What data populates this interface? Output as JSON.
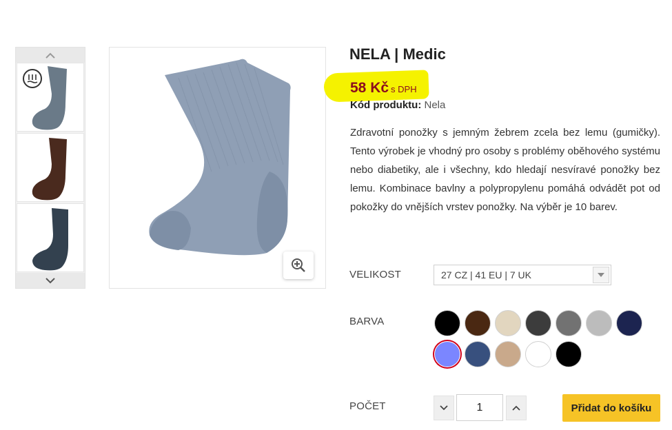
{
  "product": {
    "title": "NELA | Medic",
    "price": "58 Kč",
    "price_note": "s DPH",
    "code_label": "Kód produktu:",
    "code_value": "Nela",
    "description": "Zdravotní ponožky s jemným žebrem zcela bez lemu (gumičky). Tento výrobek je vhodný pro osoby s problémy oběhového systému nebo diabetiky, ale i všechny, kdo hledají nesvíravé ponožky bez lemu. Kombinace bavlny a polypropylenu pomáhá odvádět pot od pokožky do vnějších vrstev ponožky. Na výběr je 10 barev."
  },
  "gallery": {
    "thumbnails": [
      {
        "color": "#6a7a88"
      },
      {
        "color": "#4a2a1e"
      },
      {
        "color": "#33414f"
      }
    ],
    "main_color": "#8f9fb5",
    "badge_icon": "medical-badge-icon",
    "zoom_icon": "zoom-in-icon"
  },
  "size": {
    "label": "VELIKOST",
    "selected": "27 CZ | 41 EU | 7 UK"
  },
  "color": {
    "label": "BARVA",
    "swatches": [
      "#000000",
      "#4a2812",
      "#e2d6bf",
      "#3c3c3c",
      "#727272",
      "#bcbcbc",
      "#1c2450",
      "#7b86ff",
      "#38507e",
      "#c9a98b",
      "#ffffff",
      "#000000"
    ],
    "selected_index": 7
  },
  "quantity": {
    "label": "POČET",
    "value": "1"
  },
  "cart": {
    "button_label": "Přidat do košíku",
    "accent": "#f6c326"
  },
  "colors": {
    "price": "#8b0d1e",
    "highlight": "#f5f200"
  }
}
